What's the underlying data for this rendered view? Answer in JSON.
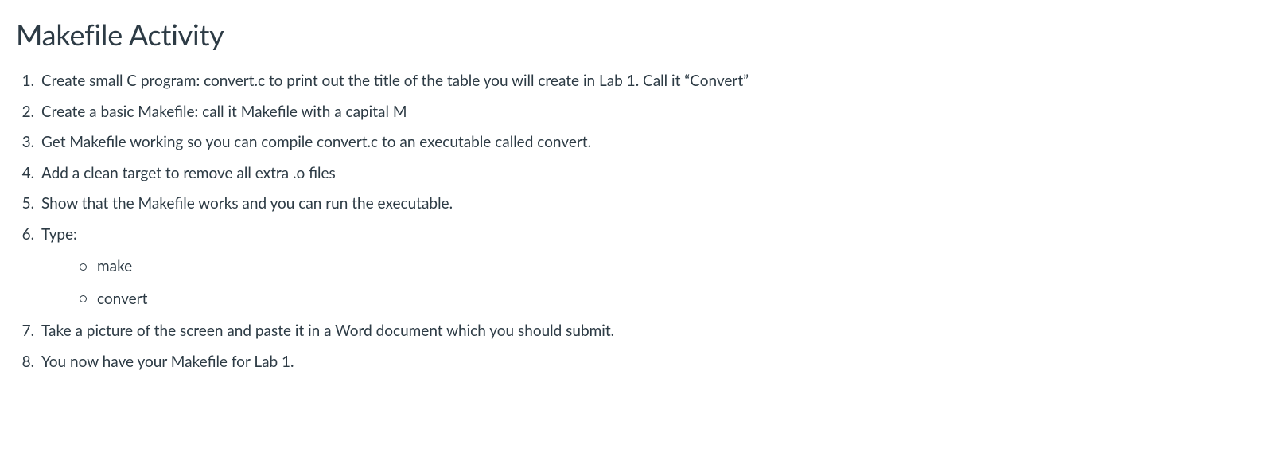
{
  "title": "Makefile Activity",
  "items": [
    "Create small C program: convert.c to print out the title of the table you will create in Lab 1. Call it “Convert”",
    "Create a basic Makefile: call it Makefile with a capital M",
    "Get Makefile working so you can compile convert.c to an executable called convert.",
    "Add a clean target to remove all extra .o files",
    "Show that the Makefile works and you can run the executable.",
    "Type:",
    "Take a picture of the screen and paste it in a Word document which you should submit.",
    "You now have your Makefile for Lab 1."
  ],
  "subitems": [
    "make",
    "convert"
  ]
}
